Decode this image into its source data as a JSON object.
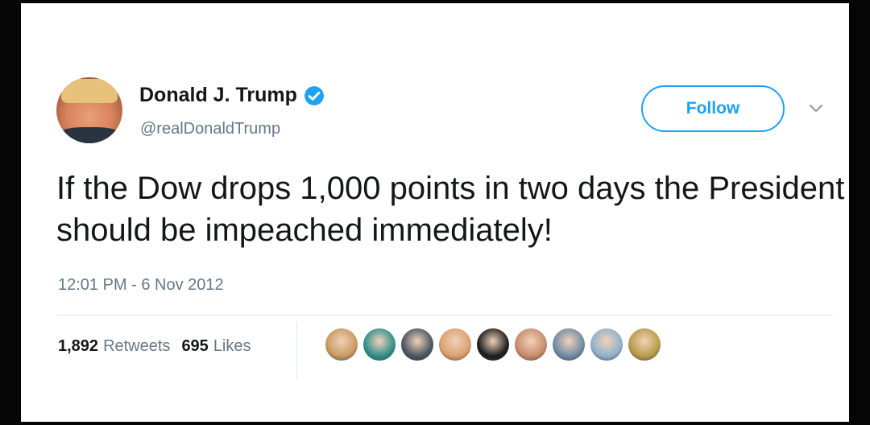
{
  "tweet": {
    "author": {
      "display_name": "Donald J. Trump",
      "handle": "@realDonaldTrump",
      "verified": true,
      "avatar_icon": "profile-photo"
    },
    "follow_label": "Follow",
    "text": "If the Dow drops 1,000 points in two days the President should be impeached immediately!",
    "timestamp": "12:01 PM - 6 Nov 2012",
    "stats": {
      "retweets_count": "1,892",
      "retweets_label": "Retweets",
      "likes_count": "695",
      "likes_label": "Likes"
    },
    "likers": [
      {
        "color": "#c89a63"
      },
      {
        "color": "#2f8f8a"
      },
      {
        "color": "#4a5563"
      },
      {
        "color": "#d9a070"
      },
      {
        "color": "#1d1d1d"
      },
      {
        "color": "#c88a6b"
      },
      {
        "color": "#6f8aa6"
      },
      {
        "color": "#8fb1cf"
      },
      {
        "color": "#b89a4a"
      }
    ]
  },
  "colors": {
    "accent": "#1da1f2",
    "text_primary": "#14171a",
    "text_secondary": "#657786"
  }
}
